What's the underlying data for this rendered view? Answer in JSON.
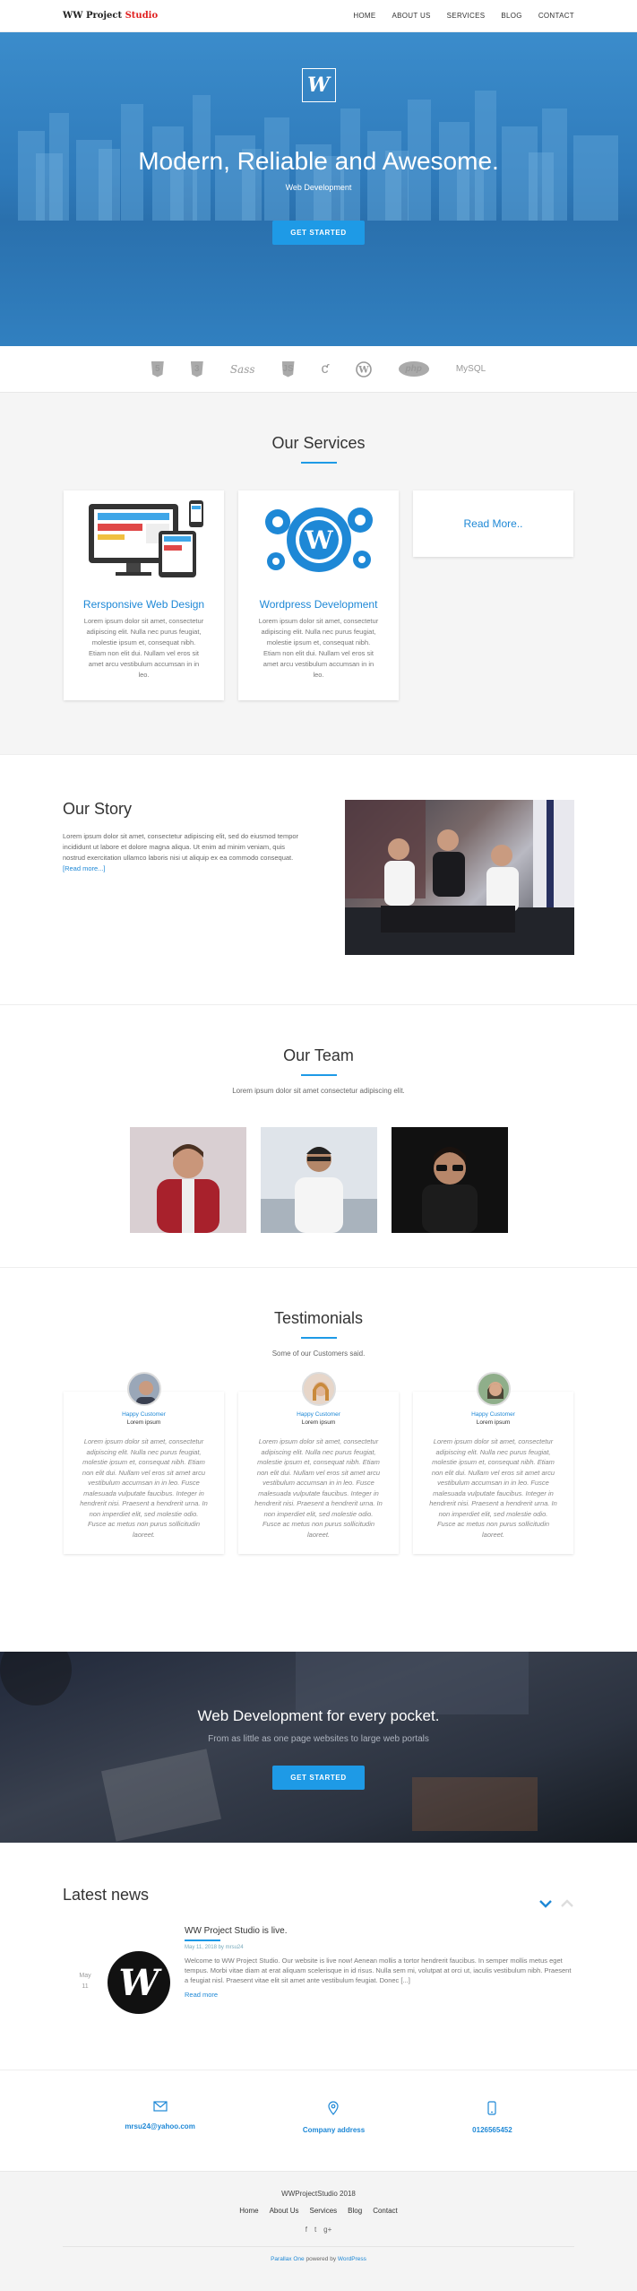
{
  "header": {
    "logo_main": "WW Project",
    "logo_accent": "Studio",
    "nav": [
      "HOME",
      "ABOUT US",
      "SERVICES",
      "BLOG",
      "CONTACT"
    ]
  },
  "hero": {
    "logo_letter": "W",
    "title": "Modern, Reliable and Awesome.",
    "subtitle": "Web Development",
    "cta": "GET STARTED"
  },
  "tech": {
    "logos": [
      "html5-icon",
      "css3-icon",
      "sass-icon",
      "javascript-icon",
      "jquery-icon",
      "wordpress-icon",
      "php-icon",
      "mysql-icon"
    ],
    "sass": "Sass",
    "php": "php",
    "mysql": "MySQL"
  },
  "services": {
    "title": "Our Services",
    "cards": [
      {
        "title": "Rersponsive Web Design",
        "text": "Lorem ipsum dolor sit amet, consectetur adipiscing elit. Nulla nec purus feugiat, molestie ipsum et, consequat nibh. Etiam non elit dui. Nullam vel eros sit amet arcu vestibulum accumsan in in leo."
      },
      {
        "title": "Wordpress Development",
        "text": "Lorem ipsum dolor sit amet, consectetur adipiscing elit. Nulla nec purus feugiat, molestie ipsum et, consequat nibh. Etiam non elit dui. Nullam vel eros sit amet arcu vestibulum accumsan in in leo."
      }
    ],
    "read_more": "Read More.."
  },
  "story": {
    "title": "Our Story",
    "text": "Lorem ipsum dolor sit amet, consectetur adipiscing elit, sed do eiusmod tempor incididunt ut labore et dolore magna aliqua. Ut enim ad minim veniam, quis nostrud exercitation ullamco laboris nisi ut aliquip ex ea commodo consequat.",
    "more": "[Read more...]"
  },
  "team": {
    "title": "Our Team",
    "subtitle": "Lorem ipsum dolor sit amet consectetur adipiscing elit."
  },
  "testimonials": {
    "title": "Testimonials",
    "subtitle": "Some of our Customers said.",
    "items": [
      {
        "role": "Happy Customer",
        "name": "Lorem ipsum",
        "text": "Lorem ipsum dolor sit amet, consectetur adipiscing elit. Nulla nec purus feugiat, molestie ipsum et, consequat nibh. Etiam non elit dui. Nullam vel eros sit amet arcu vestibulum accumsan in in leo. Fusce malesuada vulputate faucibus. Integer in hendrerit nisi. Praesent a hendrerit urna. In non imperdiet elit, sed molestie odio. Fusce ac metus non purus sollicitudin laoreet."
      },
      {
        "role": "Happy Customer",
        "name": "Lorem ipsum",
        "text": "Lorem ipsum dolor sit amet, consectetur adipiscing elit. Nulla nec purus feugiat, molestie ipsum et, consequat nibh. Etiam non elit dui. Nullam vel eros sit amet arcu vestibulum accumsan in in leo. Fusce malesuada vulputate faucibus. Integer in hendrerit nisi. Praesent a hendrerit urna. In non imperdiet elit, sed molestie odio. Fusce ac metus non purus sollicitudin laoreet."
      },
      {
        "role": "Happy Customer",
        "name": "Lorem ipsum",
        "text": "Lorem ipsum dolor sit amet, consectetur adipiscing elit. Nulla nec purus feugiat, molestie ipsum et, consequat nibh. Etiam non elit dui. Nullam vel eros sit amet arcu vestibulum accumsan in in leo. Fusce malesuada vulputate faucibus. Integer in hendrerit nisi. Praesent a hendrerit urna. In non imperdiet elit, sed molestie odio. Fusce ac metus non purus sollicitudin laoreet."
      }
    ]
  },
  "cta": {
    "title": "Web Development for every pocket.",
    "subtitle": "From as little as one page websites to large web portals",
    "button": "GET STARTED"
  },
  "news": {
    "title": "Latest news",
    "date_month": "May",
    "date_day": "11",
    "item_title": "WW Project Studio is live.",
    "meta": "May 11, 2018 by mrsu24",
    "text": "Welcome to WW Project Studio. Our website is live now! Aenean mollis a tortor hendrerit faucibus. In semper mollis metus eget tempus. Morbi vitae diam at erat aliquam scelerisque in id risus. Nulla sem mi, volutpat at orci ut, iaculis vestibulum nibh. Praesent a feugiat nisl. Praesent vitae elit sit amet ante vestibulum feugiat. Donec [...]",
    "read_more": "Read more",
    "logo_letter": "W"
  },
  "contact": {
    "email": "mrsu24@yahoo.com",
    "address": "Company address",
    "phone": "0126565452"
  },
  "footer": {
    "title": "WWProjectStudio 2018",
    "nav": [
      "Home",
      "About Us",
      "Services",
      "Blog",
      "Contact"
    ],
    "social": [
      "f",
      "t",
      "g+"
    ],
    "theme": "Parallax One",
    "powered": "powered by",
    "wp": "WordPress"
  },
  "colors": {
    "accent": "#1e9ae6",
    "hero_blue": "#2f7bbb",
    "cta_dark": "#2b323f"
  }
}
